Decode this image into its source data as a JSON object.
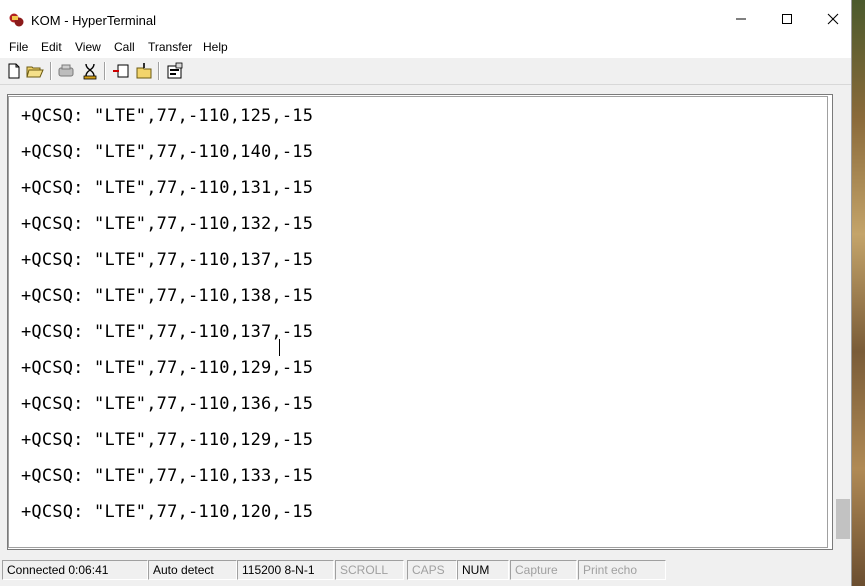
{
  "window": {
    "title": "KOM - HyperTerminal",
    "app_icon": "hyperterminal-icon",
    "controls": [
      "minimize-icon",
      "maximize-icon",
      "close-icon"
    ]
  },
  "menubar": {
    "items": [
      {
        "label": "File"
      },
      {
        "label": "Edit"
      },
      {
        "label": "View"
      },
      {
        "label": "Call"
      },
      {
        "label": "Transfer"
      },
      {
        "label": "Help"
      }
    ]
  },
  "toolbar": {
    "icons": [
      "new-connection-icon",
      "open-icon",
      "disconnect-icon",
      "dial-icon",
      "send-icon",
      "receive-icon",
      "properties-icon"
    ]
  },
  "terminal": {
    "lines": [
      "+QCSQ: \"LTE\",77,-110,125,-15",
      "+QCSQ: \"LTE\",77,-110,140,-15",
      "+QCSQ: \"LTE\",77,-110,131,-15",
      "+QCSQ: \"LTE\",77,-110,132,-15",
      "+QCSQ: \"LTE\",77,-110,137,-15",
      "+QCSQ: \"LTE\",77,-110,138,-15",
      "+QCSQ: \"LTE\",77,-110,137,-15",
      "+QCSQ: \"LTE\",77,-110,129,-15",
      "+QCSQ: \"LTE\",77,-110,136,-15",
      "+QCSQ: \"LTE\",77,-110,129,-15",
      "+QCSQ: \"LTE\",77,-110,133,-15",
      "+QCSQ: \"LTE\",77,-110,120,-15"
    ]
  },
  "statusbar": {
    "connected": "Connected 0:06:41",
    "detect": "Auto detect",
    "port_settings": "115200 8-N-1",
    "scroll": "SCROLL",
    "caps": "CAPS",
    "num": "NUM",
    "capture": "Capture",
    "print_echo": "Print echo"
  }
}
